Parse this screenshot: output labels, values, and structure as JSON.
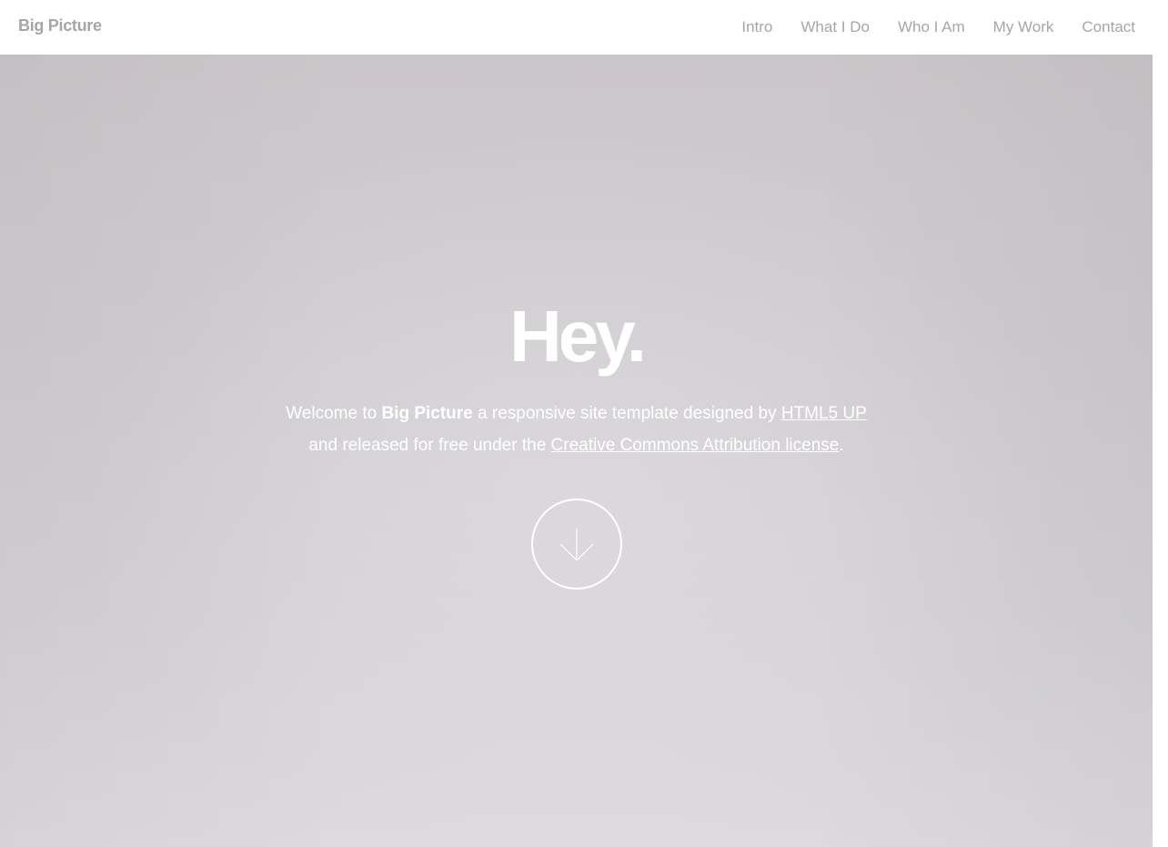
{
  "header": {
    "brand": "Big Picture",
    "nav": [
      {
        "label": "Intro"
      },
      {
        "label": "What I Do"
      },
      {
        "label": "Who I Am"
      },
      {
        "label": "My Work"
      },
      {
        "label": "Contact"
      }
    ]
  },
  "hero": {
    "title": "Hey.",
    "text_welcome": "Welcome to",
    "text_brand": "Big Picture",
    "text_designed_by": "a responsive site template designed by",
    "link_html5up": "HTML5 UP",
    "text_released": "and released for free under the",
    "link_license": "Creative Commons Attribution license",
    "text_period": ".",
    "scroll_icon": "arrow-down-icon"
  },
  "colors": {
    "header_bg": "#ffffff",
    "nav_text": "#a6a6a6",
    "hero_text": "#ffffff"
  }
}
